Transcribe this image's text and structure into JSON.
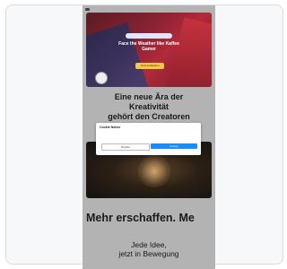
{
  "hero": {
    "badge": "",
    "title": "Face the Weather like Kaffee Gamer",
    "cta": "Jetzt entdecken"
  },
  "headline": {
    "line1": "Eine neue Ära der",
    "line2": "Kreativität",
    "line3": "gehört den Creatoren"
  },
  "big_line": "Mehr erschaffen. Me",
  "sub_line": {
    "line1": "Jede Idee,",
    "line2": "jetzt in Bewegung"
  },
  "cookie_modal": {
    "title": "Cookie Notice",
    "body": "",
    "decline": "Decline",
    "accept": "Accept"
  },
  "colors": {
    "accept_button": "#1a8cff",
    "cta_button": "#f4c84b",
    "page_bg": "#b3b3b3"
  }
}
